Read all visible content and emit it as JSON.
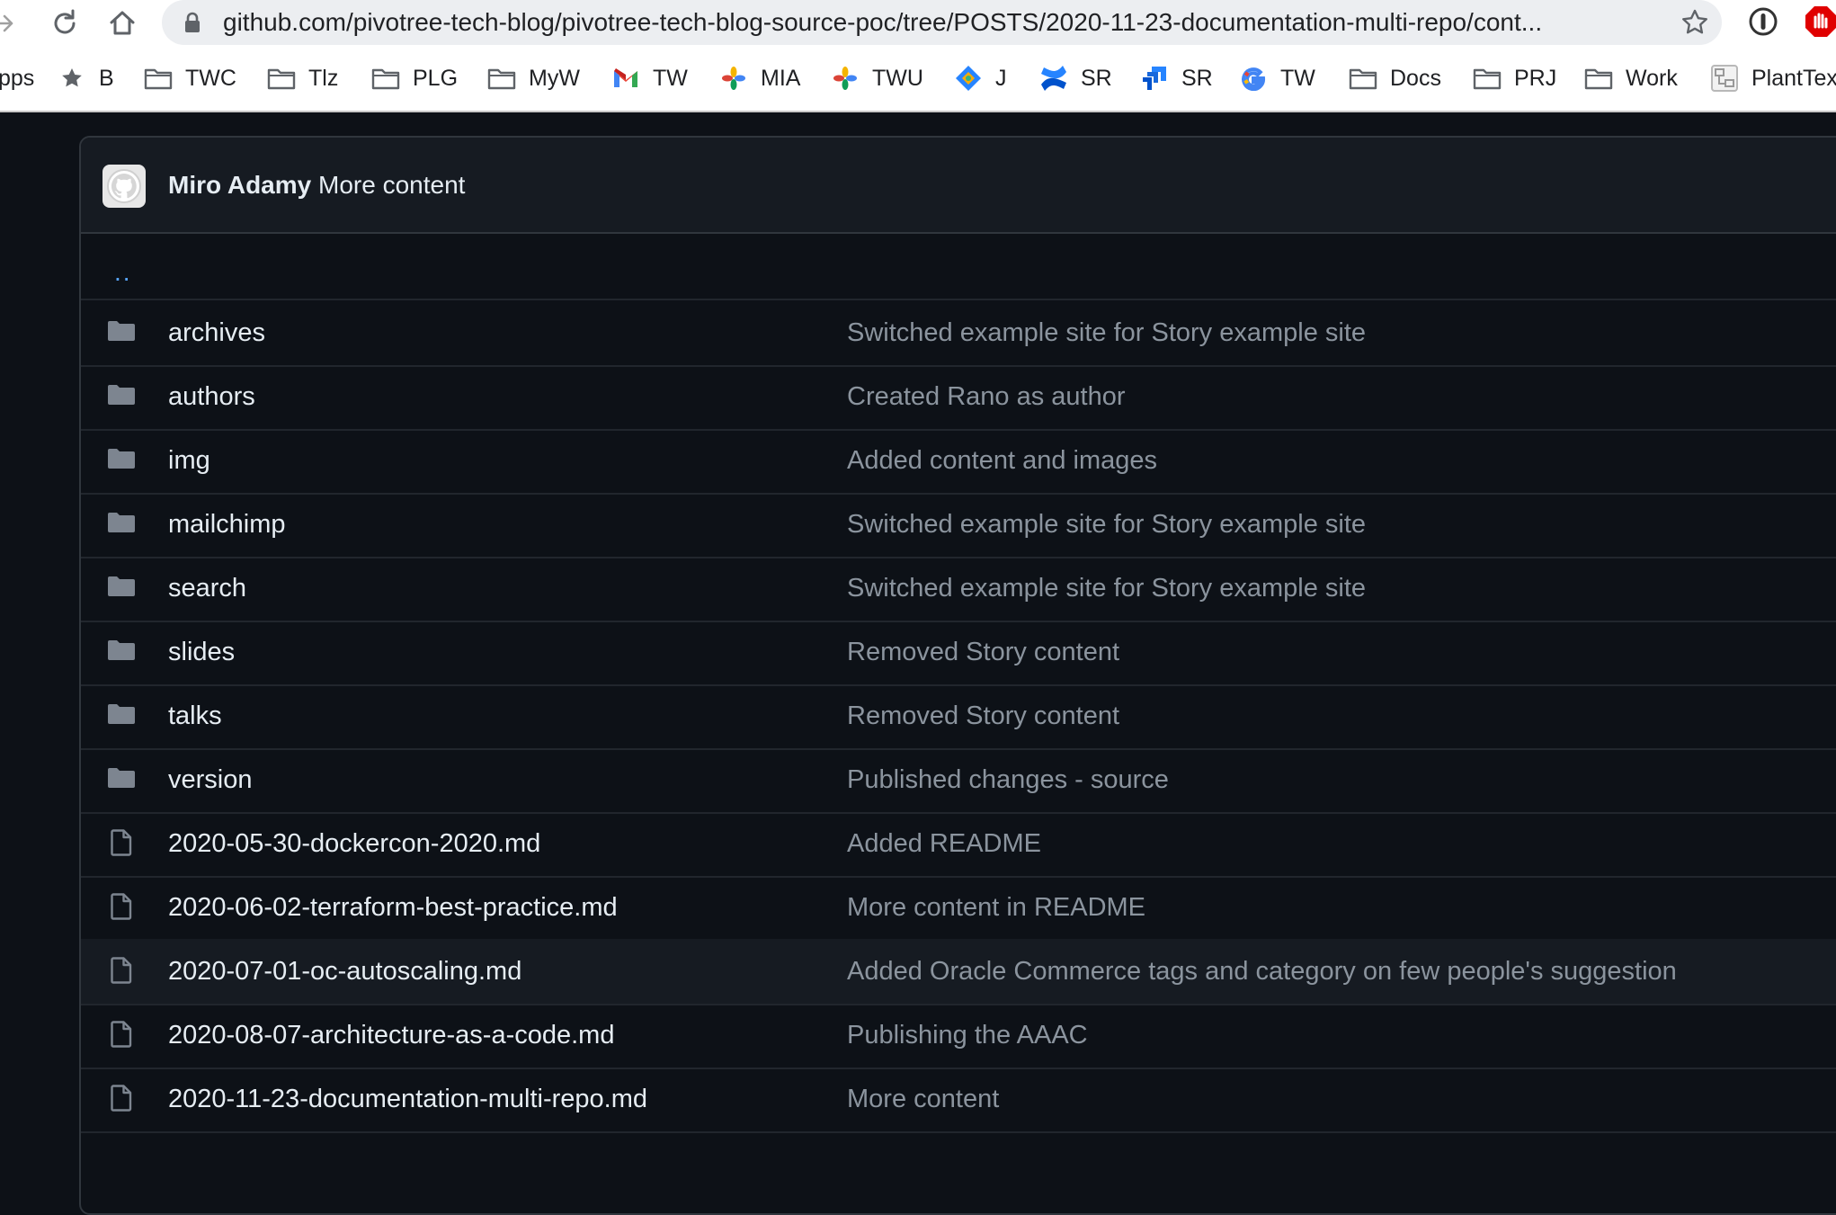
{
  "browser": {
    "url": "github.com/pivotree-tech-blog/pivotree-tech-blog-source-poc/tree/POSTS/2020-11-23-documentation-multi-repo/cont...",
    "bookmarks": [
      {
        "label": "pps",
        "icon": "apps-icon"
      },
      {
        "label": "B",
        "icon": "star-icon"
      },
      {
        "label": "TWC",
        "icon": "folder-icon"
      },
      {
        "label": "Tlz",
        "icon": "folder-icon"
      },
      {
        "label": "PLG",
        "icon": "folder-icon"
      },
      {
        "label": "MyW",
        "icon": "folder-icon"
      },
      {
        "label": "TW",
        "icon": "gmail-icon"
      },
      {
        "label": "MIA",
        "icon": "pinwheel-icon"
      },
      {
        "label": "TWU",
        "icon": "pinwheel-icon"
      },
      {
        "label": "J",
        "icon": "jira-icon"
      },
      {
        "label": "SR",
        "icon": "confluence-icon"
      },
      {
        "label": "SR",
        "icon": "jira-software-icon"
      },
      {
        "label": "TW",
        "icon": "google-icon"
      },
      {
        "label": "Docs",
        "icon": "folder-icon"
      },
      {
        "label": "PRJ",
        "icon": "folder-icon"
      },
      {
        "label": "Work",
        "icon": "folder-icon"
      },
      {
        "label": "PlantTex",
        "icon": "planttext-icon"
      }
    ]
  },
  "commit": {
    "author": "Miro Adamy",
    "message": "More content"
  },
  "parent_link": "..",
  "files": [
    {
      "name": "archives",
      "type": "folder",
      "message": "Switched example site for Story example site"
    },
    {
      "name": "authors",
      "type": "folder",
      "message": "Created Rano as author"
    },
    {
      "name": "img",
      "type": "folder",
      "message": "Added content and images"
    },
    {
      "name": "mailchimp",
      "type": "folder",
      "message": "Switched example site for Story example site"
    },
    {
      "name": "search",
      "type": "folder",
      "message": "Switched example site for Story example site"
    },
    {
      "name": "slides",
      "type": "folder",
      "message": "Removed Story content"
    },
    {
      "name": "talks",
      "type": "folder",
      "message": "Removed Story content"
    },
    {
      "name": "version",
      "type": "folder",
      "message": "Published changes - source"
    },
    {
      "name": "2020-05-30-dockercon-2020.md",
      "type": "file",
      "message": "Added README"
    },
    {
      "name": "2020-06-02-terraform-best-practice.md",
      "type": "file",
      "message": "More content in README"
    },
    {
      "name": "2020-07-01-oc-autoscaling.md",
      "type": "file",
      "message": "Added Oracle Commerce tags and category on few people's suggestion"
    },
    {
      "name": "2020-08-07-architecture-as-a-code.md",
      "type": "file",
      "message": "Publishing the AAAC"
    },
    {
      "name": "2020-11-23-documentation-multi-repo.md",
      "type": "file",
      "message": "More content"
    }
  ]
}
